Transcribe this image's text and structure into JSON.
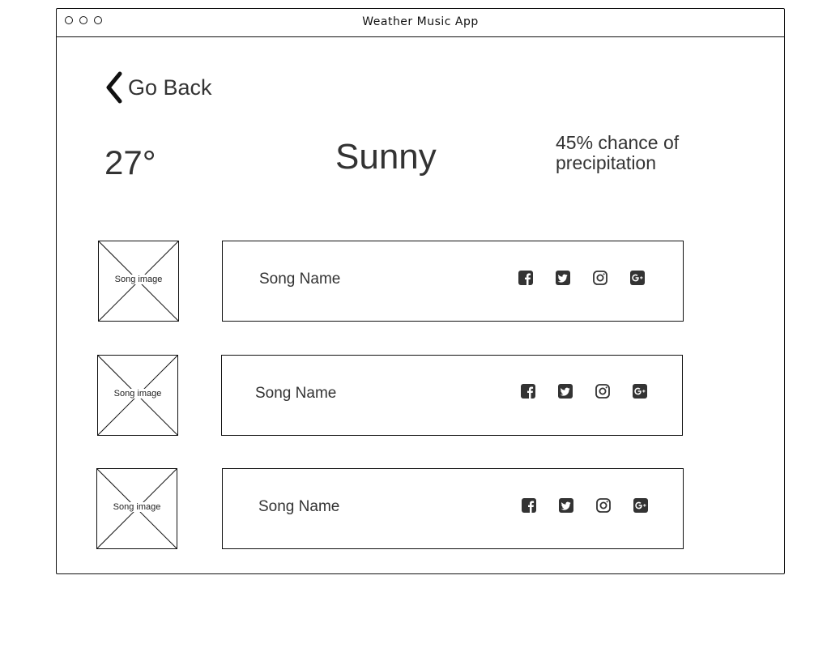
{
  "window": {
    "title": "Weather Music App"
  },
  "nav": {
    "go_back_label": "Go Back"
  },
  "weather": {
    "temperature": "27°",
    "condition": "Sunny",
    "precipitation": "45% chance of precipitation"
  },
  "songs": [
    {
      "image_label": "Song image",
      "name": "Song Name"
    },
    {
      "image_label": "Song image",
      "name": "Song Name"
    },
    {
      "image_label": "Song image",
      "name": "Song Name"
    }
  ],
  "social_icons": [
    "facebook-icon",
    "twitter-icon",
    "instagram-icon",
    "google-plus-icon"
  ],
  "colors": {
    "ink": "#111111",
    "icon_fill": "#333333",
    "text": "#333333"
  }
}
